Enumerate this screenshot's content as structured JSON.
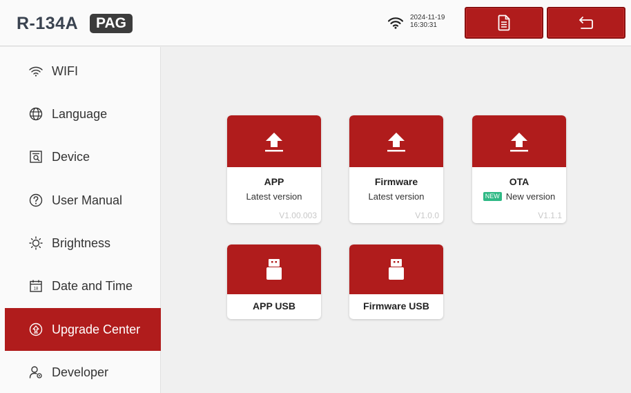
{
  "header": {
    "title": "R-134A",
    "badge": "PAG",
    "date": "2024-11-19",
    "time": "16:30:31",
    "accent": "#b01c1c"
  },
  "sidebar": {
    "items": [
      {
        "label": "WIFI",
        "icon": "wifi-icon"
      },
      {
        "label": "Language",
        "icon": "globe-icon"
      },
      {
        "label": "Device",
        "icon": "device-icon"
      },
      {
        "label": "User Manual",
        "icon": "help-icon"
      },
      {
        "label": "Brightness",
        "icon": "sun-icon"
      },
      {
        "label": "Date and Time",
        "icon": "calendar-icon"
      },
      {
        "label": "Upgrade Center",
        "icon": "upgrade-icon",
        "active": true
      },
      {
        "label": "Developer",
        "icon": "developer-icon"
      }
    ]
  },
  "cards": [
    {
      "name": "APP",
      "status": "Latest version",
      "version": "V1.00.003"
    },
    {
      "name": "Firmware",
      "status": "Latest version",
      "version": "V1.0.0"
    },
    {
      "name": "OTA",
      "status": "New version",
      "version": "V1.1.1",
      "badge": "NEW"
    }
  ],
  "usb_cards": [
    {
      "name": "APP USB"
    },
    {
      "name": "Firmware USB"
    }
  ]
}
